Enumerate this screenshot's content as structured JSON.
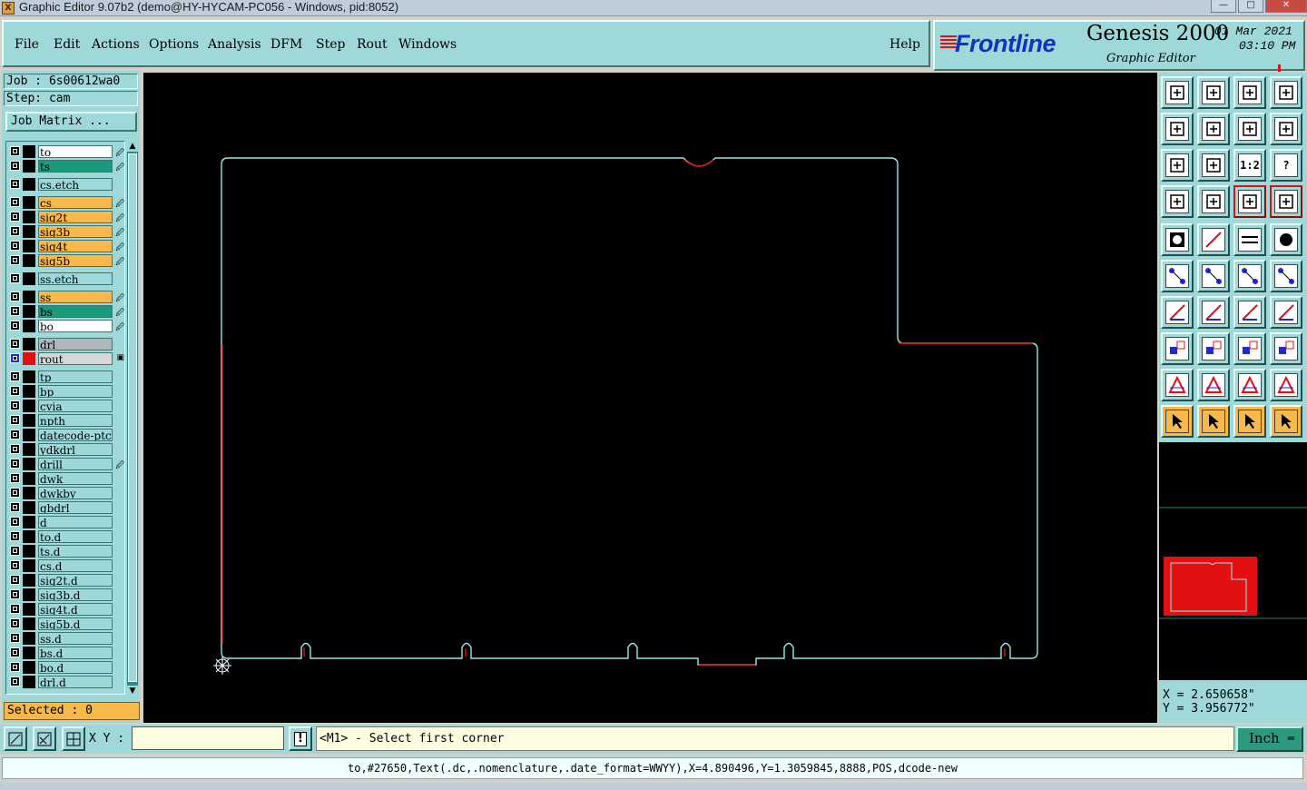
{
  "window": {
    "title": "Graphic Editor 9.07b2 (demo@HY-HYCAM-PC056 - Windows, pid:8052)",
    "min": "—",
    "max": "□",
    "close": "✕"
  },
  "menu": {
    "file": "File",
    "edit": "Edit",
    "actions": "Actions",
    "options": "Options",
    "analysis": "Analysis",
    "dfm": "DFM",
    "step": "Step",
    "rout": "Rout",
    "windows": "Windows",
    "help": "Help"
  },
  "brand": {
    "logo": "Frontline",
    "product": "Genesis 2000",
    "subtitle": "Graphic Editor",
    "date": "01 Mar 2021",
    "time": "03:10 PM",
    "accent": "#1530c0"
  },
  "job": {
    "job_line": "Job : 6s00612wa0",
    "step_line": "Step: cam",
    "job_matrix": "Job Matrix ..."
  },
  "layers": [
    {
      "name": "to",
      "color": "#ffffff",
      "flag": "🖉"
    },
    {
      "name": "ts",
      "color": "#1a9a7a",
      "flag": "🖉"
    },
    {
      "name": "cs.etch",
      "color": "#9fd8d8",
      "flag": ""
    },
    {
      "name": "cs",
      "color": "#f9b84a",
      "flag": "🖉"
    },
    {
      "name": "sig2t",
      "color": "#f9b84a",
      "flag": "🖉"
    },
    {
      "name": "sig3b",
      "color": "#f9b84a",
      "flag": "🖉"
    },
    {
      "name": "sig4t",
      "color": "#f9b84a",
      "flag": "🖉"
    },
    {
      "name": "sig5b",
      "color": "#f9b84a",
      "flag": "🖉"
    },
    {
      "name": "ss.etch",
      "color": "#9fd8d8",
      "flag": ""
    },
    {
      "name": "ss",
      "color": "#f9b84a",
      "flag": "🖉"
    },
    {
      "name": "bs",
      "color": "#1a9a7a",
      "flag": "🖉"
    },
    {
      "name": "bo",
      "color": "#ffffff",
      "flag": "🖉"
    },
    {
      "name": "drl",
      "color": "#b0b8bc",
      "flag": ""
    },
    {
      "name": "rout",
      "color": "#d8d8d8",
      "flag": "▣"
    },
    {
      "name": "tp",
      "color": "#9fd8d8",
      "flag": ""
    },
    {
      "name": "bp",
      "color": "#9fd8d8",
      "flag": ""
    },
    {
      "name": "cvia",
      "color": "#9fd8d8",
      "flag": ""
    },
    {
      "name": "npth",
      "color": "#9fd8d8",
      "flag": ""
    },
    {
      "name": "datecode-ptc",
      "color": "#9fd8d8",
      "flag": ""
    },
    {
      "name": "ydkdrl",
      "color": "#9fd8d8",
      "flag": ""
    },
    {
      "name": "drill",
      "color": "#9fd8d8",
      "flag": "🖉"
    },
    {
      "name": "dwk",
      "color": "#9fd8d8",
      "flag": ""
    },
    {
      "name": "dwkby",
      "color": "#9fd8d8",
      "flag": ""
    },
    {
      "name": "gbdrl",
      "color": "#9fd8d8",
      "flag": ""
    },
    {
      "name": "d",
      "color": "#9fd8d8",
      "flag": ""
    },
    {
      "name": "to.d",
      "color": "#9fd8d8",
      "flag": ""
    },
    {
      "name": "ts.d",
      "color": "#9fd8d8",
      "flag": ""
    },
    {
      "name": "cs.d",
      "color": "#9fd8d8",
      "flag": ""
    },
    {
      "name": "sig2t.d",
      "color": "#9fd8d8",
      "flag": ""
    },
    {
      "name": "sig3b.d",
      "color": "#9fd8d8",
      "flag": ""
    },
    {
      "name": "sig4t.d",
      "color": "#9fd8d8",
      "flag": ""
    },
    {
      "name": "sig5b.d",
      "color": "#9fd8d8",
      "flag": ""
    },
    {
      "name": "ss.d",
      "color": "#9fd8d8",
      "flag": ""
    },
    {
      "name": "bs.d",
      "color": "#9fd8d8",
      "flag": ""
    },
    {
      "name": "bo.d",
      "color": "#9fd8d8",
      "flag": ""
    },
    {
      "name": "drl.d",
      "color": "#9fd8d8",
      "flag": ""
    }
  ],
  "selected": "Selected : 0",
  "scroll": {
    "up": "▲",
    "down": "▼"
  },
  "toolbar": {
    "ratio_label": "1:2",
    "help_label": "?"
  },
  "coords": {
    "x": "X = 2.650658\"",
    "y": "Y = 3.956772\""
  },
  "bottom": {
    "xy_label": "X Y :",
    "xy_value": "",
    "prompt": "<M1> - Select first corner",
    "units": "Inch",
    "units_arrow": "═"
  },
  "status": "to,#27650,Text(.dc,.nomenclature,.date_format=WWYY),X=4.890496,Y=1.3059845,8888,POS,dcode-new",
  "colors": {
    "panel": "#9fd8d8",
    "highlight": "#f9b84a",
    "outline": "#9ee6e6",
    "rout": "#e21010"
  }
}
